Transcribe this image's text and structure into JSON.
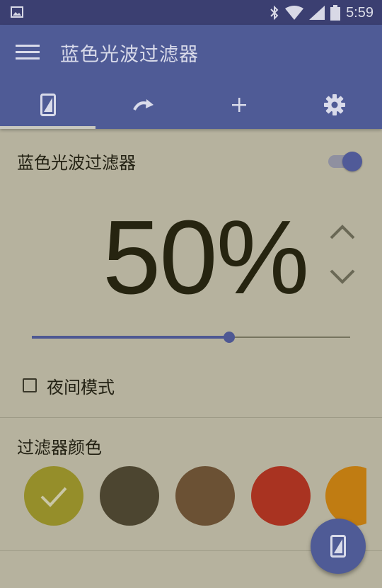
{
  "statusbar": {
    "time": "5:59"
  },
  "appbar": {
    "title": "蓝色光波过滤器",
    "tabs": [
      {
        "name": "tab-filter",
        "icon": "phone-filter-icon",
        "active": true
      },
      {
        "name": "tab-schedule",
        "icon": "redo-icon",
        "active": false
      },
      {
        "name": "tab-add",
        "icon": "plus-icon",
        "active": false
      },
      {
        "name": "tab-settings",
        "icon": "gear-icon",
        "active": false
      }
    ]
  },
  "filter": {
    "toggle_label": "蓝色光波过滤器",
    "enabled": true,
    "percent_text": "50%",
    "slider_fraction": 0.62
  },
  "night_mode": {
    "label": "夜间模式",
    "checked": false
  },
  "colors": {
    "section_title": "过滤器颜色",
    "swatches": [
      "#958e2a",
      "#4c4530",
      "#6b5134",
      "#a93321",
      "#c07c12"
    ],
    "selected_index": 0
  },
  "theme": {
    "accent": "#4f5b96",
    "statusbar": "#3b3f71",
    "background": "#b6b29e"
  }
}
